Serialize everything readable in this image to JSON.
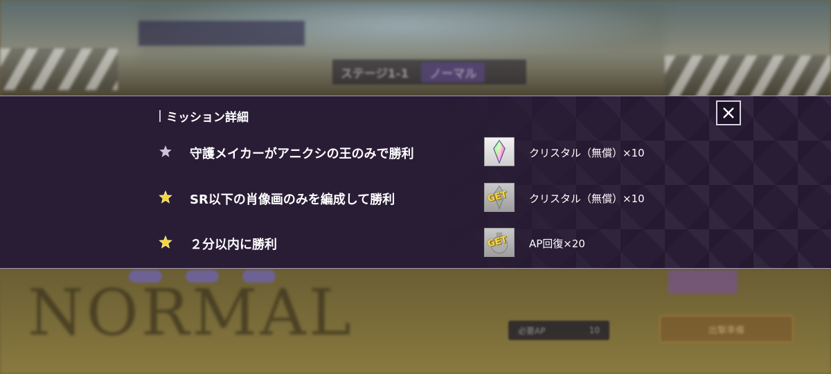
{
  "background": {
    "stage_label": "ステージ1-1",
    "difficulty_pill": "ノーマル",
    "difficulty_big": "NORMAL",
    "ap_label": "必要AP",
    "ap_value": "10",
    "start_button": "出撃準備"
  },
  "panel": {
    "title": "ミッション詳細",
    "close_icon": "close-icon",
    "colors": {
      "panel_bg": "#291d36",
      "star_done": "#f5d63a",
      "star_pending": "#c9c3d4"
    },
    "missions": [
      {
        "text": "守護メイカーがアニクシの王のみで勝利",
        "achieved": false,
        "reward_icon": "crystal-icon",
        "reward_claimed": false,
        "reward_text": "クリスタル（無償）×10"
      },
      {
        "text": "SR以下の肖像画のみを編成して勝利",
        "achieved": true,
        "reward_icon": "crystal-icon",
        "reward_claimed": true,
        "reward_badge": "GET",
        "reward_text": "クリスタル（無償）×10"
      },
      {
        "text": "２分以内に勝利",
        "achieved": true,
        "reward_icon": "ap-potion-icon",
        "reward_claimed": true,
        "reward_badge": "GET",
        "reward_text": "AP回復×20"
      }
    ]
  }
}
